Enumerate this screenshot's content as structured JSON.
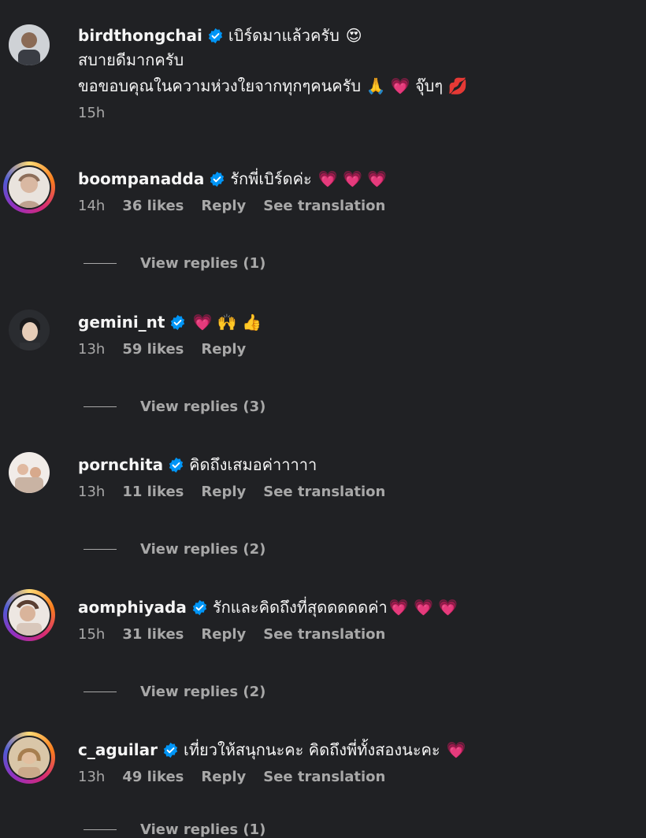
{
  "comments": [
    {
      "username": "birdthongchai",
      "text": "เบิร์ดมาแล้วครับ",
      "emoji": "😍",
      "extra_lines": [
        "สบายดีมากครับ",
        "ขอขอบคุณในความห่วงใยจากทุกๆคนครับ 🙏 💗 จุ๊บๆ 💋"
      ],
      "time": "15h",
      "likes": "",
      "reply": "",
      "translation": "",
      "view_replies": ""
    },
    {
      "username": "boompanadda",
      "text": "รักพี่เบิร์ดค่ะ",
      "emoji": "💗 💗 💗",
      "time": "14h",
      "likes": "36 likes",
      "reply": "Reply",
      "translation": "See translation",
      "view_replies": "View replies (1)"
    },
    {
      "username": "gemini_nt",
      "text": "",
      "emoji": "💗 🙌 👍",
      "time": "13h",
      "likes": "59 likes",
      "reply": "Reply",
      "translation": "",
      "view_replies": "View replies (3)"
    },
    {
      "username": "pornchita",
      "text": "คิดถึงเสมอค่าาาาา",
      "emoji": "",
      "time": "13h",
      "likes": "11 likes",
      "reply": "Reply",
      "translation": "See translation",
      "view_replies": "View replies (2)"
    },
    {
      "username": "aomphiyada",
      "text": "รักและคิดถึงที่สุดดดดดค่า",
      "emoji": "💗 💗 💗",
      "time": "15h",
      "likes": "31 likes",
      "reply": "Reply",
      "translation": "See translation",
      "view_replies": "View replies (2)"
    },
    {
      "username": "c_aguilar",
      "text": "เที่ยวให้สนุกนะคะ คิดถึงพี่ทั้งสองนะคะ",
      "emoji": "💗",
      "time": "13h",
      "likes": "49 likes",
      "reply": "Reply",
      "translation": "See translation",
      "view_replies": "View replies (1)"
    }
  ],
  "icons": {
    "verified": "verified-badge-icon"
  },
  "colors": {
    "background": "#202124",
    "verified": "#0095f6",
    "muted": "#a8a8a8",
    "text": "#f5f5f5"
  }
}
